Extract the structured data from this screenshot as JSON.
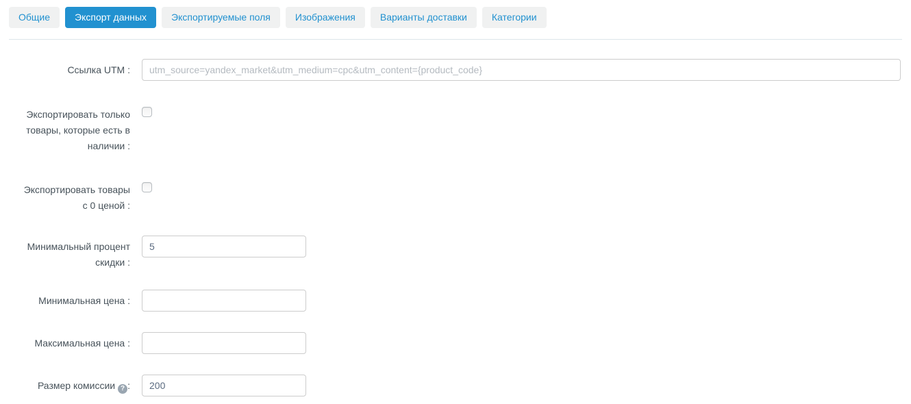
{
  "tabs": [
    {
      "label": "Общие",
      "active": false
    },
    {
      "label": "Экспорт данных",
      "active": true
    },
    {
      "label": "Экспортируемые поля",
      "active": false
    },
    {
      "label": "Изображения",
      "active": false
    },
    {
      "label": "Варианты доставки",
      "active": false
    },
    {
      "label": "Категории",
      "active": false
    }
  ],
  "form": {
    "utm_link": {
      "label": "Ссылка UTM :",
      "value": "",
      "placeholder": "utm_source=yandex_market&utm_medium=cpc&utm_content={product_code}"
    },
    "export_in_stock_only": {
      "label": "Экспортировать только товары, которые есть в наличии :",
      "checked": false
    },
    "export_zero_price": {
      "label": "Экспортировать товары с 0 ценой :",
      "checked": false
    },
    "min_discount_percent": {
      "label": "Минимальный процент скидки :",
      "value": "5"
    },
    "min_price": {
      "label": "Минимальная цена :",
      "value": ""
    },
    "max_price": {
      "label": "Максимальная цена :",
      "value": ""
    },
    "commission": {
      "label": "Размер комиссии",
      "colon": ":",
      "value": "200"
    }
  },
  "icons": {
    "help_glyph": "?"
  },
  "colors": {
    "accent": "#2191d0",
    "tab_inactive_bg": "#f0f1f1",
    "input_border": "#cccccc",
    "label_text": "#47525a",
    "input_text": "#5b6b80",
    "placeholder_text": "#b4bac0",
    "divider": "#dde6ea",
    "help_icon_bg": "#9aa6b1"
  }
}
